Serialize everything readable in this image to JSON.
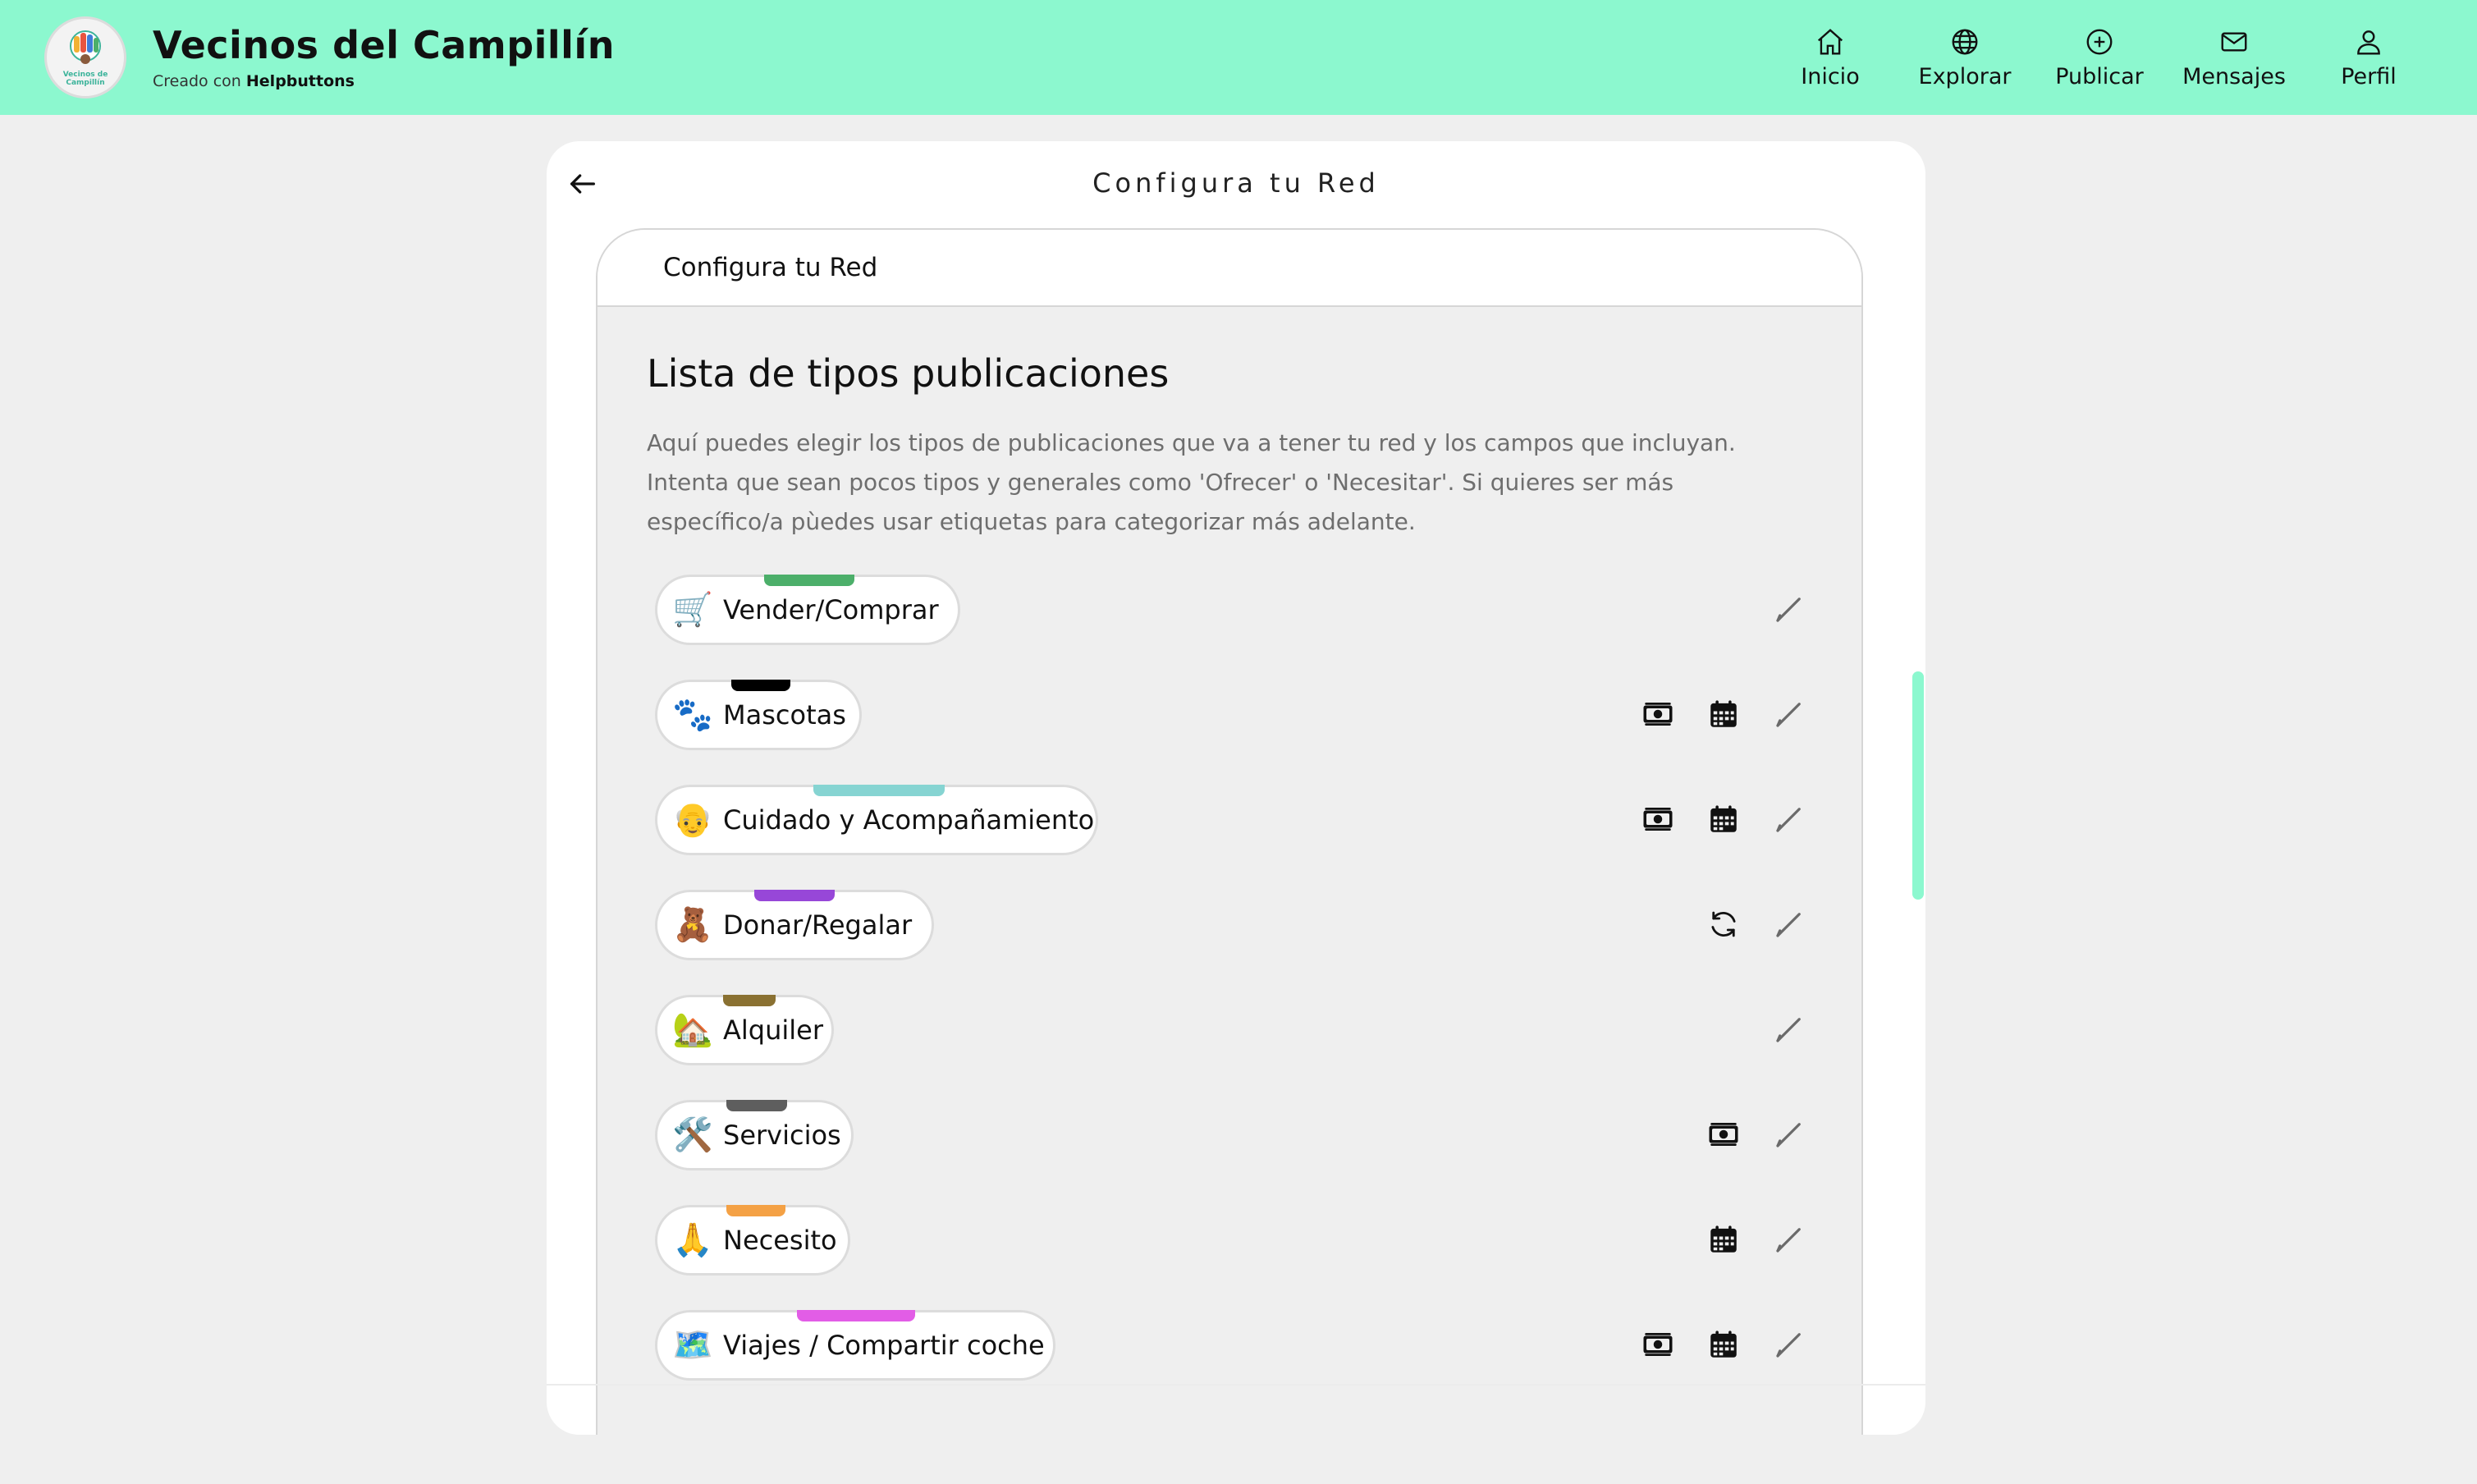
{
  "header": {
    "logo_text": "Vecinos de Campillín",
    "title": "Vecinos del Campillín",
    "subtitle_prefix": "Creado con",
    "subtitle_brand": "Helpbuttons",
    "nav": [
      {
        "label": "Inicio",
        "icon": "home-icon"
      },
      {
        "label": "Explorar",
        "icon": "globe-icon"
      },
      {
        "label": "Publicar",
        "icon": "plus-circle-icon"
      },
      {
        "label": "Mensajes",
        "icon": "mail-icon"
      },
      {
        "label": "Perfil",
        "icon": "user-icon"
      }
    ]
  },
  "card": {
    "title": "Configura tu Red",
    "tab_label": "Configura tu Red",
    "section_title": "Lista de tipos publicaciones",
    "description": "Aquí puedes elegir los tipos de publicaciones que va a tener tu red y los campos que incluyan. Intenta que sean pocos tipos y generales como 'Ofrecer' o 'Necesitar'. Si quieres ser más específico/a pùedes usar etiquetas para categorizar más adelante.",
    "types": [
      {
        "emoji": "🛒",
        "label": "Vender/Comprar",
        "color": "#4caf6a",
        "price": false,
        "date": false,
        "recurrent": false
      },
      {
        "emoji": "🐾",
        "label": "Mascotas",
        "color": "#000000",
        "price": true,
        "date": true,
        "recurrent": false
      },
      {
        "emoji": "👴",
        "label": "Cuidado y Acompañamiento",
        "color": "#86d4d2",
        "price": true,
        "date": true,
        "recurrent": false
      },
      {
        "emoji": "🧸",
        "label": "Donar/Regalar",
        "color": "#9747d8",
        "price": false,
        "date": false,
        "recurrent": true
      },
      {
        "emoji": "🏡",
        "label": "Alquiler",
        "color": "#8a7132",
        "price": false,
        "date": false,
        "recurrent": false
      },
      {
        "emoji": "🛠️",
        "label": "Servicios",
        "color": "#5e5e5e",
        "price": true,
        "date": false,
        "recurrent": false
      },
      {
        "emoji": "🙏",
        "label": "Necesito",
        "color": "#f4a145",
        "price": false,
        "date": true,
        "recurrent": false
      },
      {
        "emoji": "🗺️",
        "label": "Viajes / Compartir coche",
        "color": "#e25de6",
        "price": true,
        "date": true,
        "recurrent": false
      }
    ]
  }
}
